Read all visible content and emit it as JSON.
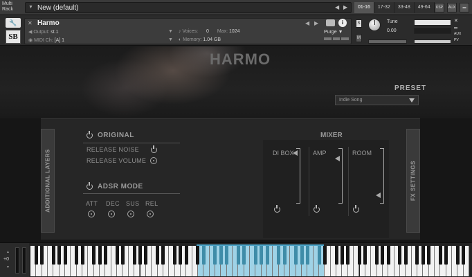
{
  "topbar": {
    "multi_rack_label": "Multi Rack",
    "rack_name": "New (default)",
    "ranges": [
      "01-16",
      "17-32",
      "33-48",
      "49-64"
    ],
    "active_range": "01-16",
    "buttons": [
      "KSP",
      "AUX"
    ]
  },
  "instrument": {
    "name": "Harmo",
    "output_label": "Output:",
    "output_value": "st.1",
    "midi_label": "MIDI Ch:",
    "midi_value": "[A]  1",
    "voices_label": "Voices:",
    "voices_value": "0",
    "max_label": "Max:",
    "max_value": "1024",
    "memory_label": "Memory:",
    "memory_value": "1.04 GB",
    "purge_label": "Purge",
    "tune_label": "Tune",
    "tune_value": "0.00",
    "s_button": "S",
    "m_button": "M",
    "aux_label": "AUX",
    "pv_label": "PV"
  },
  "logo": {
    "text": "SB"
  },
  "main": {
    "title": "HARMO",
    "preset_label": "PRESET",
    "preset_value": "Indie Song",
    "left_tab": "ADDITIONAL LAYERS",
    "right_tab": "FX SETTINGS",
    "original": {
      "heading": "ORIGINAL",
      "release_noise": "RELEASE NOISE",
      "release_volume": "RELEASE VOLUME"
    },
    "adsr": {
      "heading": "ADSR MODE",
      "labels": [
        "ATT",
        "DEC",
        "SUS",
        "REL"
      ]
    },
    "mixer": {
      "heading": "MIXER",
      "channels": [
        "DI BOX",
        "AMP",
        "ROOM"
      ]
    }
  },
  "keyboard": {
    "octave_value": "+0"
  }
}
